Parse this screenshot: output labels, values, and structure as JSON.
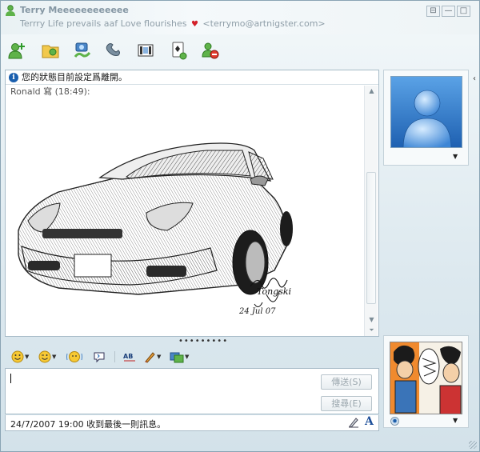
{
  "window": {
    "contact_name": "Terry Meeeeeeeeeeee",
    "personal_message": "Terrry Life prevails aaf Love flourishes",
    "contact_email": "<terrymo@artnigster.com>",
    "controls": {
      "restore": "⊟",
      "minimize": "—",
      "maximize": "□",
      "close": "✕"
    }
  },
  "toolbar": {
    "buttons": [
      {
        "name": "invite-contact-icon"
      },
      {
        "name": "send-files-icon"
      },
      {
        "name": "video-call-icon"
      },
      {
        "name": "phone-call-icon"
      },
      {
        "name": "activities-icon"
      },
      {
        "name": "games-icon"
      },
      {
        "name": "block-contact-icon"
      }
    ]
  },
  "chat": {
    "status_notice": "您的狀態目前設定爲離開。",
    "sender_line": "Ronald 寫 (18:49):",
    "drawing_signature": "Tongski",
    "drawing_date": "24 Jul 07"
  },
  "compose_toolbar": {
    "items": [
      "emoticon-icon",
      "wink-icon",
      "nudge-icon",
      "voice-clip-icon",
      "spell-check-icon",
      "ink-icon",
      "background-icon"
    ]
  },
  "compose": {
    "value": "",
    "send_label": "傳送(S)",
    "search_label": "搜尋(E)"
  },
  "statusbar": {
    "last_message": "24/7/2007 19:00 收到最後一則訊息。"
  },
  "colors": {
    "accent": "#1a5fae",
    "heart": "#d3202a",
    "avatar_bg": "#2f74c6"
  }
}
